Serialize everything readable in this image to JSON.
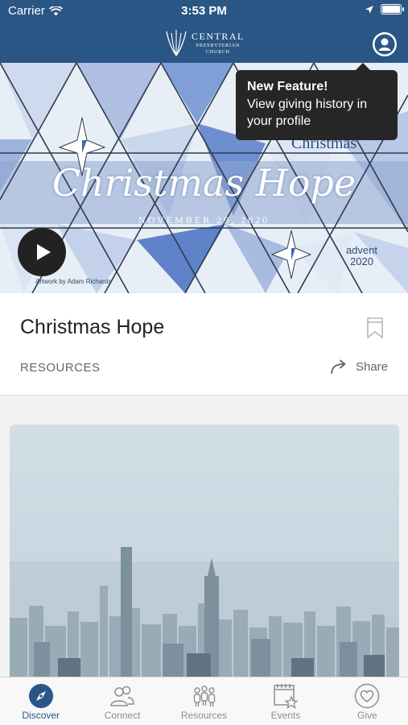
{
  "status_bar": {
    "carrier": "Carrier",
    "time": "3:53 PM"
  },
  "header": {
    "logo": {
      "line1": "CENTRAL",
      "line2": "PRESBYTERIAN",
      "line3": "CHURCH"
    },
    "profile_icon": "person-circle-icon"
  },
  "tooltip": {
    "title": "New Feature!",
    "body": "View giving history in your profile"
  },
  "hero": {
    "title": "Christmas Hope",
    "date": "NOVEMBER 29, 2020",
    "credit": "Artwork by Adam Richards",
    "badge_line1": "advent",
    "badge_line2": "2020",
    "background_word": "Christmas"
  },
  "content": {
    "title": "Christmas Hope",
    "category": "RESOURCES",
    "share_label": "Share"
  },
  "tabs": [
    {
      "label": "Discover",
      "icon": "compass-icon",
      "active": true
    },
    {
      "label": "Connect",
      "icon": "people-icon",
      "active": false
    },
    {
      "label": "Resources",
      "icon": "group-icon",
      "active": false
    },
    {
      "label": "Events",
      "icon": "calendar-star-icon",
      "active": false
    },
    {
      "label": "Give",
      "icon": "heart-icon",
      "active": false
    }
  ],
  "colors": {
    "brand_blue": "#2a5686",
    "tooltip_bg": "#262626",
    "tab_inactive": "#8e8e8e"
  }
}
